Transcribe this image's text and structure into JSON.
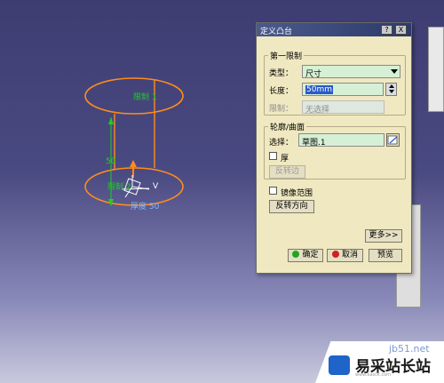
{
  "dialog": {
    "title": "定义凸台",
    "help_glyph": "?",
    "close_glyph": "X",
    "first_limit": {
      "group_label": "第一限制",
      "type_label": "类型：",
      "type_value": "尺寸",
      "length_label": "长度：",
      "length_value": "50mm",
      "limit_label": "限制：",
      "limit_value": "无选择"
    },
    "profile": {
      "group_label": "轮廓/曲面",
      "select_label": "选择：",
      "select_value": "草图.1",
      "thick_label": "厚",
      "reverse_side_label": "反转边"
    },
    "mirror_label": "镜像范围",
    "reverse_direction_label": "反转方向",
    "more_label": "更多>>",
    "ok_label": "确定",
    "cancel_label": "取消",
    "preview_label": "预览"
  },
  "viewport": {
    "limit1_label": "限制 1",
    "limit2_label": "限制 2",
    "dimension_value": "50",
    "axis_v": "V",
    "wall_label": "厚度 50",
    "shape_color": "#ff8c1a",
    "label_color": "#19d219"
  },
  "watermark": {
    "url": "jb51.net",
    "brand": "易采站长站",
    "sub": "www.easck.com"
  }
}
